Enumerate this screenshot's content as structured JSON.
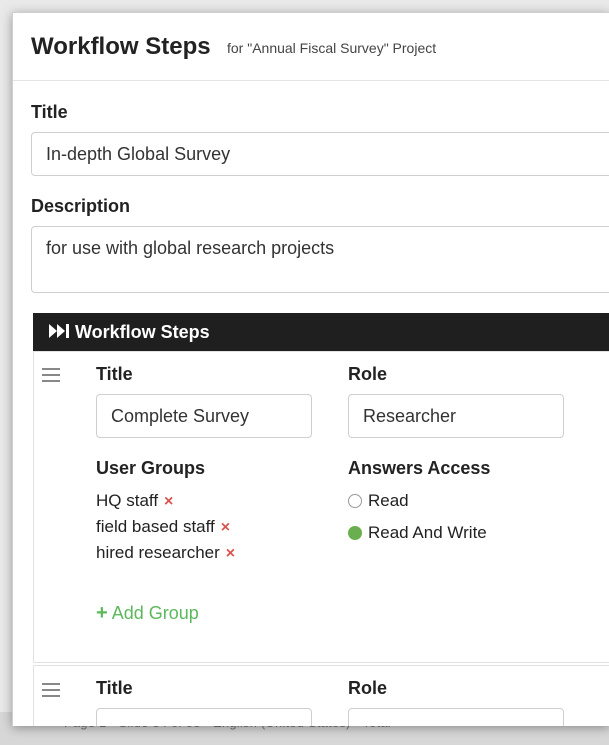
{
  "header": {
    "title": "Workflow Steps",
    "subtitle": "for \"Annual Fiscal Survey\" Project"
  },
  "form": {
    "title_label": "Title",
    "title_value": "In-depth Global Survey",
    "description_label": "Description",
    "description_value": "for use with global research projects"
  },
  "steps_section": {
    "title": "Workflow Steps",
    "icon": "fast-forward-icon"
  },
  "steps": [
    {
      "title_label": "Title",
      "title_value": "Complete Survey",
      "role_label": "Role",
      "role_value": "Researcher",
      "user_groups_label": "User Groups",
      "groups": [
        "HQ staff",
        "field based staff",
        "hired researcher"
      ],
      "remove_symbol": "×",
      "add_group_label": "Add Group",
      "answers_access_label": "Answers Access",
      "access_options": [
        "Read",
        "Read And Write"
      ],
      "selected_access": "Read And Write"
    },
    {
      "title_label": "Title",
      "role_label": "Role"
    }
  ],
  "statusbar": {
    "text": "Page 1 · Slide 34 of 58 · English (United States) · Total"
  },
  "colors": {
    "steps_bar_bg": "#1f1f1f",
    "add_group_green": "#5cb85c",
    "remove_red": "#d9534f",
    "radio_selected": "#6aaf4f"
  }
}
